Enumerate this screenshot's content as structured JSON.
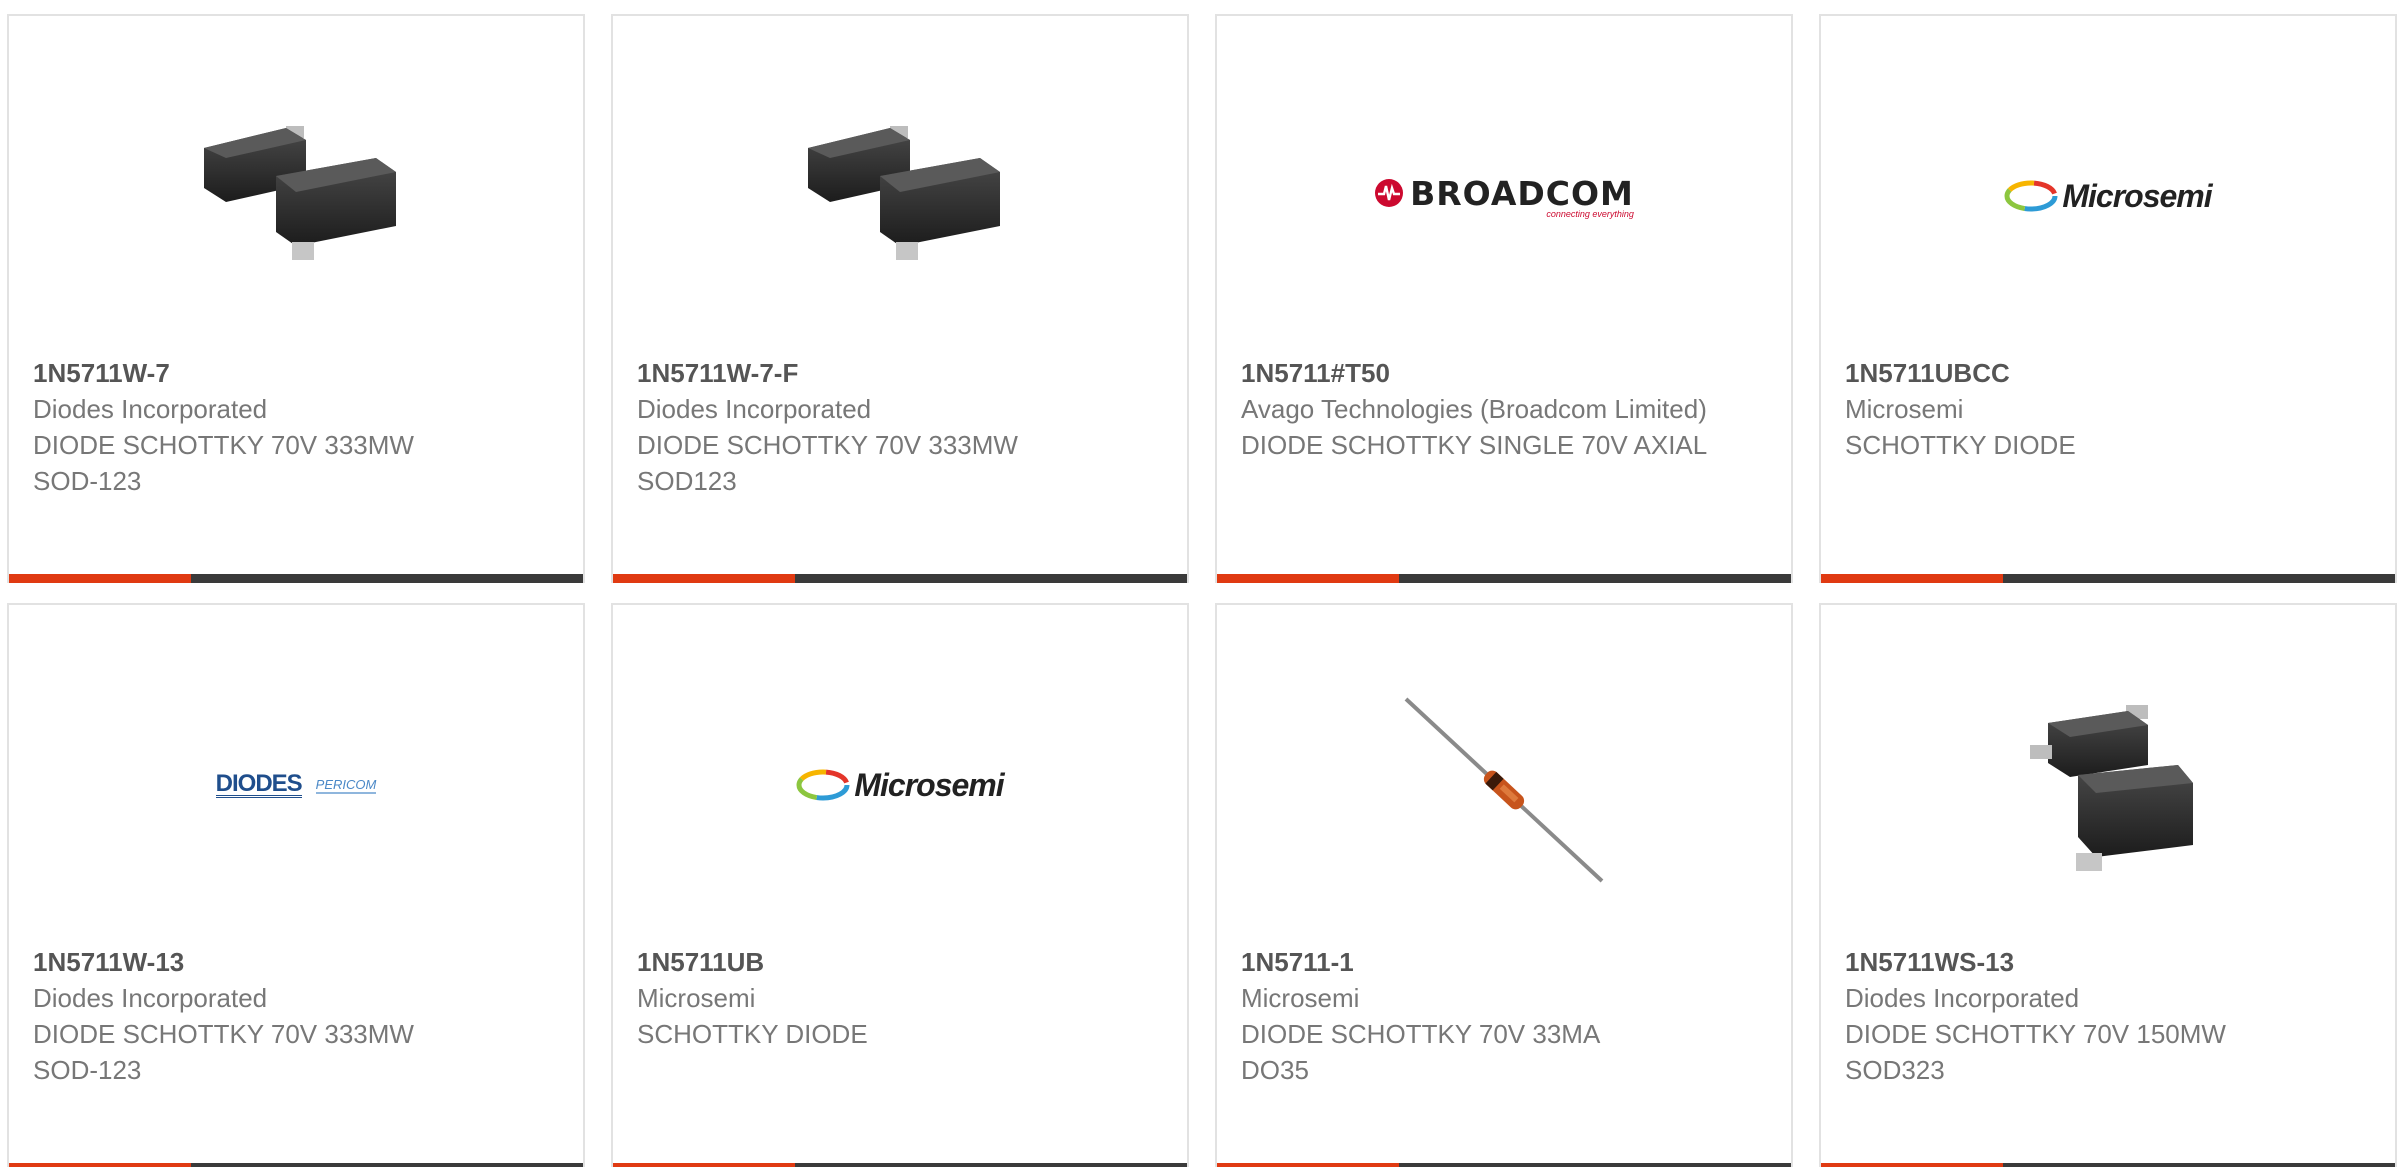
{
  "products": [
    {
      "part_number": "1N5711W-7",
      "manufacturer": "Diodes Incorporated",
      "description": [
        "DIODE SCHOTTKY 70V 333MW",
        "SOD-123"
      ],
      "image": "sod123-package"
    },
    {
      "part_number": "1N5711W-7-F",
      "manufacturer": "Diodes Incorporated",
      "description": [
        "DIODE SCHOTTKY 70V 333MW",
        "SOD123"
      ],
      "image": "sod123-package"
    },
    {
      "part_number": "1N5711#T50",
      "manufacturer": "Avago Technologies (Broadcom Limited)",
      "description": [
        "DIODE SCHOTTKY SINGLE 70V AXIAL"
      ],
      "image": "broadcom-logo"
    },
    {
      "part_number": "1N5711UBCC",
      "manufacturer": "Microsemi",
      "description": [
        "SCHOTTKY DIODE"
      ],
      "image": "microsemi-logo"
    },
    {
      "part_number": "1N5711W-13",
      "manufacturer": "Diodes Incorporated",
      "description": [
        "DIODE SCHOTTKY 70V 333MW",
        "SOD-123"
      ],
      "image": "diodes-pericom-logo"
    },
    {
      "part_number": "1N5711UB",
      "manufacturer": "Microsemi",
      "description": [
        "SCHOTTKY DIODE"
      ],
      "image": "microsemi-logo"
    },
    {
      "part_number": "1N5711-1",
      "manufacturer": "Microsemi",
      "description": [
        "DIODE SCHOTTKY 70V 33MA",
        "DO35"
      ],
      "image": "axial-diode"
    },
    {
      "part_number": "1N5711WS-13",
      "manufacturer": "Diodes Incorporated",
      "description": [
        "DIODE SCHOTTKY 70V 150MW",
        "SOD323"
      ],
      "image": "sod323-package"
    }
  ],
  "logos": {
    "broadcom": {
      "word": "BROADCOM",
      "tagline": "connecting everything"
    },
    "microsemi": {
      "word": "Microsemi"
    },
    "diodes": {
      "word": "DIODES",
      "secondary": "PERICOM"
    }
  },
  "colors": {
    "accent": "#e03a12",
    "bar": "#3a3a3a",
    "part_number": "#555555",
    "text": "#777777",
    "border": "#e2e2e2"
  }
}
